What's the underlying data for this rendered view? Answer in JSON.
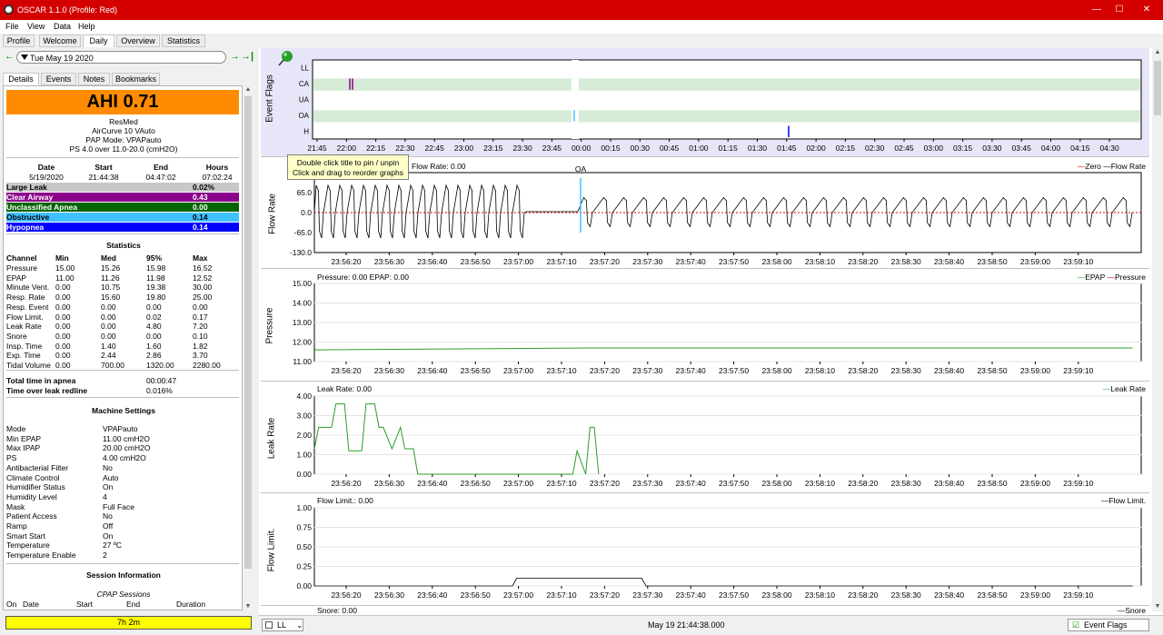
{
  "window": {
    "title": "OSCAR 1.1.0 (Profile: Red)",
    "minimize": "—",
    "maximize": "☐",
    "close": "✕"
  },
  "menu": [
    "File",
    "View",
    "Data",
    "Help"
  ],
  "tabs": [
    "Profile",
    "Welcome",
    "Daily",
    "Overview",
    "Statistics"
  ],
  "active_tab": "Daily",
  "date_nav": {
    "date": "Tue May 19 2020",
    "prev": "←",
    "next": "→",
    "next_end": "→|"
  },
  "subtabs": [
    "Details",
    "Events",
    "Notes",
    "Bookmarks"
  ],
  "ahi": {
    "label": "AHI 0.71",
    "color": "#ff8c00"
  },
  "machine": {
    "brand": "ResMed",
    "model": "AirCurve 10 VAuto",
    "mode": "PAP Mode: VPAPauto",
    "settings": "PS 4.0 over 11.0-20.0 (cmH2O)"
  },
  "session_summary": {
    "headers": [
      "Date",
      "Start",
      "End",
      "Hours"
    ],
    "values": [
      "5/19/2020",
      "21:44:38",
      "04:47:02",
      "07:02:24"
    ]
  },
  "events": [
    {
      "name": "Large Leak",
      "value": "0.02%",
      "bg": "#c8c8c8",
      "fg": "#000000"
    },
    {
      "name": "Clear Airway",
      "value": "0.43",
      "bg": "#8b008b",
      "fg": "#ffffff"
    },
    {
      "name": "Unclassified Apnea",
      "value": "0.00",
      "bg": "#006400",
      "fg": "#ffffff"
    },
    {
      "name": "Obstructive",
      "value": "0.14",
      "bg": "#40c0ff",
      "fg": "#000000"
    },
    {
      "name": "Hypopnea",
      "value": "0.14",
      "bg": "#0000ff",
      "fg": "#ffffff"
    }
  ],
  "statistics": {
    "title": "Statistics",
    "headers": [
      "Channel",
      "Min",
      "Med",
      "95%",
      "Max"
    ],
    "rows": [
      [
        "Pressure",
        "15.00",
        "15.26",
        "15.98",
        "16.52"
      ],
      [
        "EPAP",
        "11.00",
        "11.26",
        "11.98",
        "12.52"
      ],
      [
        "Minute Vent.",
        "0.00",
        "10.75",
        "19.38",
        "30.00"
      ],
      [
        "Resp. Rate",
        "0.00",
        "15.60",
        "19.80",
        "25.00"
      ],
      [
        "Resp. Event",
        "0.00",
        "0.00",
        "0.00",
        "0.00"
      ],
      [
        "Flow Limit.",
        "0.00",
        "0.00",
        "0.02",
        "0.17"
      ],
      [
        "Leak Rate",
        "0.00",
        "0.00",
        "4.80",
        "7.20"
      ],
      [
        "Snore",
        "0.00",
        "0.00",
        "0.00",
        "0.10"
      ],
      [
        "Insp. Time",
        "0.00",
        "1.40",
        "1.60",
        "1.82"
      ],
      [
        "Exp. Time",
        "0.00",
        "2.44",
        "2.86",
        "3.70"
      ],
      [
        "Tidal Volume",
        "0.00",
        "700.00",
        "1320.00",
        "2280.00"
      ]
    ]
  },
  "totals": [
    {
      "label": "Total time in apnea",
      "value": "00:00:47"
    },
    {
      "label": "Time over leak redline",
      "value": "0.016%"
    }
  ],
  "machine_settings": {
    "title": "Machine Settings",
    "rows": [
      [
        "Mode",
        "VPAPauto"
      ],
      [
        "Min EPAP",
        "11.00 cmH2O"
      ],
      [
        "Max IPAP",
        "20.00 cmH2O"
      ],
      [
        "PS",
        "4.00 cmH2O"
      ],
      [
        "Antibacterial Filter",
        "No"
      ],
      [
        "Climate Control",
        "Auto"
      ],
      [
        "Humidifier Status",
        "On"
      ],
      [
        "Humidity Level",
        "4"
      ],
      [
        "Mask",
        "Full Face"
      ],
      [
        "Patient Access",
        "No"
      ],
      [
        "Ramp",
        "Off"
      ],
      [
        "Smart Start",
        "On"
      ],
      [
        "Temperature",
        "27 ºC"
      ],
      [
        "Temperature Enable",
        "2"
      ]
    ]
  },
  "session_info": {
    "title": "Session Information",
    "subtitle": "CPAP Sessions",
    "headers": [
      "On",
      "Date",
      "Start",
      "End",
      "Duration"
    ]
  },
  "total_hours": "7h 2m",
  "tooltip": {
    "line1": "Double click title to pin / unpin",
    "line2": "Click and drag to reorder graphs"
  },
  "event_flags": {
    "ytitle": "Event Flags",
    "rows": [
      "LL",
      "CA",
      "UA",
      "OA",
      "H"
    ],
    "xticks": [
      "21:45",
      "22:00",
      "22:15",
      "22:30",
      "22:45",
      "23:00",
      "23:15",
      "23:30",
      "23:45",
      "00:00",
      "00:15",
      "00:30",
      "00:45",
      "01:00",
      "01:15",
      "01:30",
      "01:45",
      "02:00",
      "02:15",
      "02:30",
      "02:45",
      "03:00",
      "03:15",
      "03:30",
      "03:45",
      "04:00",
      "04:15",
      "04:30"
    ]
  },
  "time_ticks": [
    "23:56:20",
    "23:56:30",
    "23:56:40",
    "23:56:50",
    "23:57:00",
    "23:57:10",
    "23:57:20",
    "23:57:30",
    "23:57:40",
    "23:57:50",
    "23:58:00",
    "23:58:10",
    "23:58:20",
    "23:58:30",
    "23:58:40",
    "23:58:50",
    "23:59:00",
    "23:59:10"
  ],
  "flow_rate": {
    "ytitle": "Flow Rate",
    "header": "Flow Rate: 0.00",
    "legend_a": "Zero",
    "legend_b": "Flow Rate",
    "yticks": [
      "65.0",
      "0.0",
      "-65.0",
      "-130.0"
    ],
    "event_label": "OA"
  },
  "pressure": {
    "ytitle": "Pressure",
    "header": "Pressure: 0.00 EPAP: 0.00",
    "legend_a": "EPAP",
    "legend_b": "Pressure",
    "yticks": [
      "15.00",
      "14.00",
      "13.00",
      "12.00",
      "11.00"
    ]
  },
  "leak_rate": {
    "ytitle": "Leak Rate",
    "header": "Leak Rate: 0.00",
    "legend": "Leak Rate",
    "yticks": [
      "4.00",
      "3.00",
      "2.00",
      "1.00",
      "0.00"
    ]
  },
  "flow_limit": {
    "ytitle": "Flow Limit.",
    "header": "Flow Limit.: 0.00",
    "legend": "Flow Limit.",
    "yticks": [
      "1.00",
      "0.75",
      "0.50",
      "0.25",
      "0.00"
    ]
  },
  "snore": {
    "header": "Snore: 0.00",
    "legend": "Snore"
  },
  "footer": {
    "left_select": "LL",
    "center": "May 19 21:44:38.000",
    "right_label": "Event Flags"
  },
  "chart_data": [
    {
      "type": "line",
      "title": "Leak Rate",
      "ylabel": "Leak Rate",
      "ylim": [
        0,
        4
      ],
      "x": [
        "23:56:13",
        "23:56:14",
        "23:56:17",
        "23:56:18",
        "23:56:20",
        "23:56:21",
        "23:56:24",
        "23:56:25",
        "23:56:27",
        "23:56:28",
        "23:56:29",
        "23:56:31",
        "23:56:33",
        "23:56:34",
        "23:56:36",
        "23:56:37",
        "23:57:13",
        "23:57:14",
        "23:57:16",
        "23:57:17",
        "23:57:18",
        "23:57:19"
      ],
      "series": [
        {
          "name": "Leak Rate",
          "values": [
            1.3,
            2.4,
            2.4,
            3.6,
            3.6,
            1.2,
            1.2,
            3.6,
            3.6,
            2.4,
            2.4,
            1.3,
            2.4,
            1.3,
            1.3,
            0.0,
            0.0,
            1.2,
            0.0,
            2.4,
            2.4,
            0.0
          ]
        }
      ]
    },
    {
      "type": "line",
      "title": "Pressure",
      "ylabel": "Pressure",
      "ylim": [
        11,
        15
      ],
      "x": [
        "23:56:13",
        "23:57:20",
        "23:59:23"
      ],
      "series": [
        {
          "name": "EPAP",
          "values": [
            11.6,
            11.7,
            11.7
          ]
        }
      ]
    },
    {
      "type": "line",
      "title": "Flow Limit.",
      "ylabel": "Flow Limit.",
      "ylim": [
        0,
        1
      ],
      "x": [
        "23:56:13",
        "23:56:59",
        "23:57:00",
        "23:57:29",
        "23:57:30",
        "23:59:23"
      ],
      "series": [
        {
          "name": "Flow Limit.",
          "values": [
            0,
            0,
            0.1,
            0.1,
            0,
            0
          ]
        }
      ]
    }
  ]
}
